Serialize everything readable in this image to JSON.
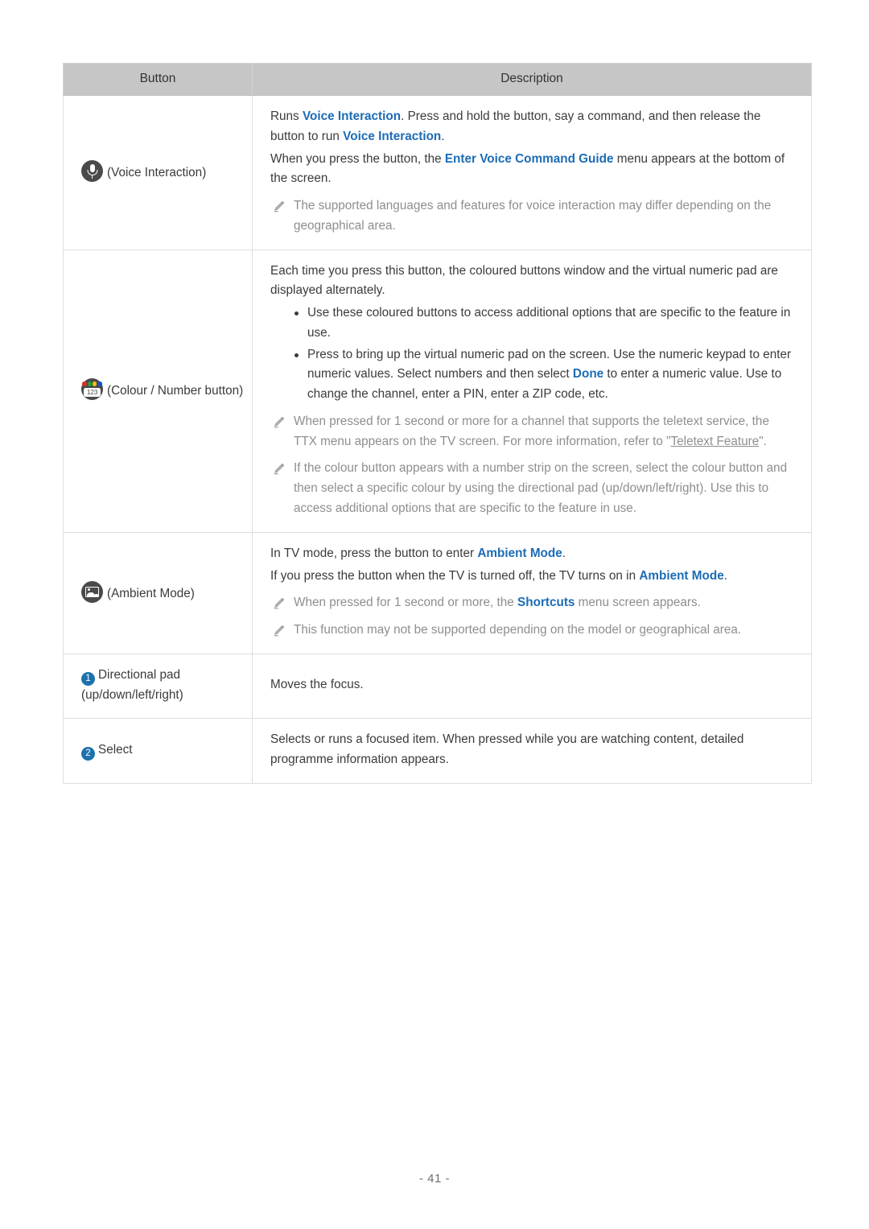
{
  "document": {
    "page_label": "- 41 -"
  },
  "table": {
    "headers": [
      "Button",
      "Description"
    ],
    "rows": [
      {
        "button": {
          "icon": "microphone-icon",
          "label": "(Voice Interaction)"
        },
        "blocks": [
          {
            "type": "paragraph",
            "runs": [
              {
                "text": "Runs ",
                "style": "normal"
              },
              {
                "text": "Voice Interaction",
                "style": "link"
              },
              {
                "text": ". Press and hold the button, say a command, and then release the button to run ",
                "style": "normal"
              },
              {
                "text": "Voice Interaction",
                "style": "link"
              },
              {
                "text": ".",
                "style": "normal"
              }
            ]
          },
          {
            "type": "paragraph",
            "runs": [
              {
                "text": "When you press the button, the ",
                "style": "normal"
              },
              {
                "text": "Enter Voice Command Guide",
                "style": "link"
              },
              {
                "text": " menu appears at the bottom of the screen.",
                "style": "normal"
              }
            ]
          },
          {
            "type": "note",
            "icon": "pencil-icon",
            "runs": [
              {
                "text": "The supported languages and features for voice interaction may differ depending on the geographical area.",
                "style": "normal"
              }
            ]
          }
        ]
      },
      {
        "button": {
          "icon": "colour-number-icon",
          "icon_digits": "123",
          "icon_dot_colours": [
            "#d93025",
            "#1aa53c",
            "#f2c200",
            "#1a4fb5"
          ],
          "label": "(Colour / Number button)"
        },
        "blocks": [
          {
            "type": "paragraph",
            "runs": [
              {
                "text": "Each time you press this button, the coloured buttons window and the virtual numeric pad are displayed alternately.",
                "style": "normal"
              }
            ]
          },
          {
            "type": "bullets",
            "items": [
              {
                "runs": [
                  {
                    "text": "Use these coloured buttons to access additional options that are specific to the feature in use.",
                    "style": "normal"
                  }
                ]
              },
              {
                "runs": [
                  {
                    "text": "Press to bring up the virtual numeric pad on the screen. Use the numeric keypad to enter numeric values. Select numbers and then select ",
                    "style": "normal"
                  },
                  {
                    "text": "Done",
                    "style": "link"
                  },
                  {
                    "text": " to enter a numeric value. Use to change the channel, enter a PIN, enter a ZIP code, etc.",
                    "style": "normal"
                  }
                ]
              }
            ]
          },
          {
            "type": "note",
            "icon": "pencil-icon",
            "runs": [
              {
                "text": "When pressed for 1 second or more for a channel that supports the teletext service, the TTX menu appears on the TV screen. For more information, refer to \"",
                "style": "normal"
              },
              {
                "text": "Teletext Feature",
                "style": "underline"
              },
              {
                "text": "\".",
                "style": "normal"
              }
            ]
          },
          {
            "type": "note",
            "icon": "pencil-icon",
            "runs": [
              {
                "text": "If the colour button appears with a number strip on the screen, select the colour button and then select a specific colour by using the directional pad (up/down/left/right). Use this to access additional options that are specific to the feature in use.",
                "style": "normal"
              }
            ]
          }
        ]
      },
      {
        "button": {
          "icon": "ambient-mode-icon",
          "label": "(Ambient Mode)"
        },
        "blocks": [
          {
            "type": "paragraph",
            "runs": [
              {
                "text": "In TV mode, press the button to enter ",
                "style": "normal"
              },
              {
                "text": "Ambient Mode",
                "style": "link"
              },
              {
                "text": ".",
                "style": "normal"
              }
            ]
          },
          {
            "type": "paragraph",
            "runs": [
              {
                "text": "If you press the button when the TV is turned off, the TV turns on in ",
                "style": "normal"
              },
              {
                "text": "Ambient Mode",
                "style": "link"
              },
              {
                "text": ".",
                "style": "normal"
              }
            ]
          },
          {
            "type": "note",
            "icon": "pencil-icon",
            "runs": [
              {
                "text": "When pressed for 1 second or more, the ",
                "style": "normal"
              },
              {
                "text": "Shortcuts",
                "style": "link"
              },
              {
                "text": " menu screen appears.",
                "style": "normal"
              }
            ]
          },
          {
            "type": "note",
            "icon": "pencil-icon",
            "runs": [
              {
                "text": "This function may not be supported depending on the model or geographical area.",
                "style": "normal"
              }
            ]
          }
        ]
      },
      {
        "button": {
          "icon": "number-badge-1",
          "badge": "1",
          "label": "Directional pad (up/down/left/right)"
        },
        "blocks": [
          {
            "type": "paragraph",
            "runs": [
              {
                "text": "Moves the focus.",
                "style": "normal"
              }
            ]
          }
        ]
      },
      {
        "button": {
          "icon": "number-badge-2",
          "badge": "2",
          "label": "Select"
        },
        "blocks": [
          {
            "type": "paragraph",
            "runs": [
              {
                "text": "Selects or runs a focused item. When pressed while you are watching content, detailed programme information appears.",
                "style": "normal"
              }
            ]
          }
        ]
      }
    ]
  },
  "colors": {
    "link": "#1c6cb5",
    "note_text": "#8e8e8e",
    "body_text": "#3b3b3b",
    "header_bg": "#c6c6c6",
    "badge_blue": "#1c72ab",
    "icon_circle": "#4a4a4a"
  }
}
